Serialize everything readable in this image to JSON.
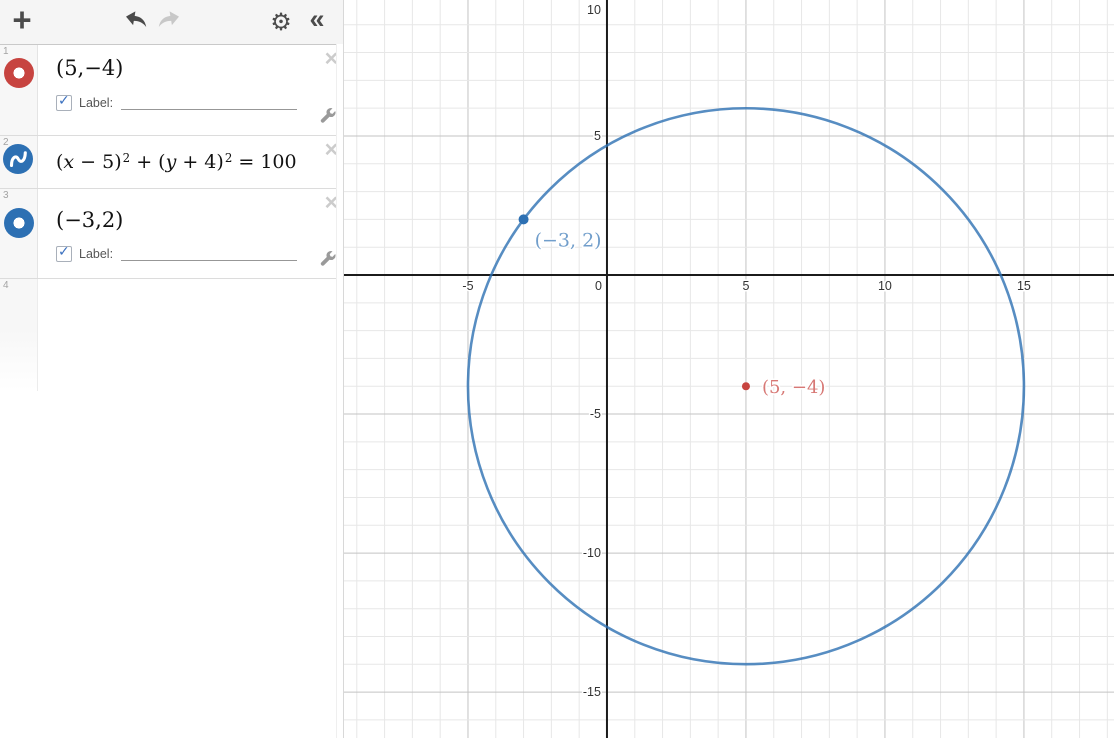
{
  "app_title": "Desmos graphing calculator",
  "colors": {
    "red": "#c74440",
    "blue": "#2d70b3",
    "axis": "#1b1b1b",
    "grid_minor": "#e7e7e7",
    "grid_major": "#c3c3c3"
  },
  "icons": {
    "plus": "+",
    "gear": "⚙︎",
    "collapse": "«",
    "close": "×",
    "check": "✓"
  },
  "expressions": [
    {
      "index": "1",
      "latex": "(5,−4)",
      "color": "#c74440",
      "label_text": "Label:",
      "label_value": "",
      "label_checked": true
    },
    {
      "index": "2",
      "color": "#2d70b3",
      "equation": "(x − 5)² + (y + 4)² = 100",
      "parts": [
        {
          "t": "("
        },
        {
          "t": "x",
          "i": 1
        },
        {
          "t": " − 5"
        },
        {
          "t": ")"
        },
        {
          "t": "2",
          "sup": 1
        },
        {
          "t": " + ("
        },
        {
          "t": "y",
          "i": 1
        },
        {
          "t": " + 4"
        },
        {
          "t": ")"
        },
        {
          "t": "2",
          "sup": 1
        },
        {
          "t": " = 100"
        }
      ]
    },
    {
      "index": "3",
      "latex": "(−3,2)",
      "color": "#2d70b3",
      "label_text": "Label:",
      "label_value": "",
      "label_checked": true
    },
    {
      "index": "4"
    }
  ],
  "chart_data": {
    "type": "scatter",
    "title": "",
    "xlabel": "",
    "ylabel": "",
    "grid": true,
    "legend": false,
    "x_axis": {
      "min": -9.46,
      "max": 18.24,
      "minor_step": 1,
      "major_step": 5,
      "tick_labels": [
        -5,
        0,
        5,
        10,
        15
      ]
    },
    "y_axis": {
      "min": -16.65,
      "max": 9.89,
      "minor_step": 1,
      "major_step": 5,
      "tick_labels": [
        10,
        5,
        -5,
        -10,
        -15
      ]
    },
    "curves": [
      {
        "name": "circle",
        "equation": "(x − 5)² + (y + 4)² = 100",
        "center": [
          5,
          -4
        ],
        "radius": 10,
        "color": "#2d70b3",
        "stroke_rgba": "rgba(45,112,179,0.8)",
        "width": 2.6
      }
    ],
    "points": [
      {
        "x": 5,
        "y": -4,
        "label": "(5, −4)",
        "color": "#c74440",
        "label_rgba": "rgba(199,68,64,0.72)",
        "radius": 4,
        "label_offset": [
          16,
          7
        ],
        "label_size": 18
      },
      {
        "x": -3,
        "y": 2,
        "label": "(−3, 2)",
        "color": "#2d70b3",
        "label_rgba": "rgba(45,112,179,0.68)",
        "radius": 5,
        "label_offset": [
          11,
          27
        ],
        "label_size": 19
      }
    ]
  }
}
